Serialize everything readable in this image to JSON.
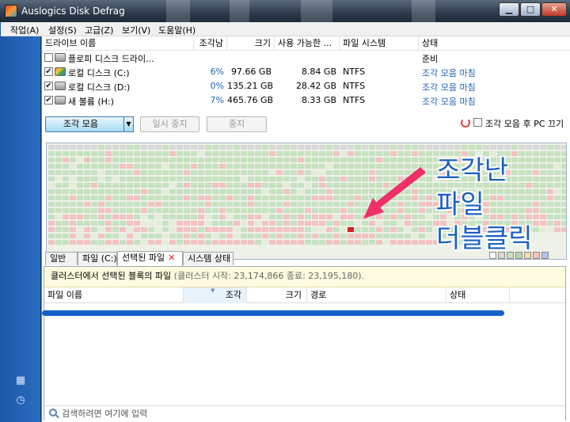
{
  "window": {
    "title": "Auslogics Disk Defrag"
  },
  "menu": [
    "작업(A)",
    "설정(S)",
    "고급(Z)",
    "보기(V)",
    "도움말(H)"
  ],
  "drive_table": {
    "headers": [
      "드라이브 이름",
      "조각남",
      "크기",
      "사용 가능한 ...",
      "파일 시스템",
      "상태"
    ],
    "rows": [
      {
        "checked": false,
        "name": "플로피 디스크 드라이...",
        "frag": "",
        "size": "",
        "free": "",
        "fs": "",
        "status": "준비",
        "icon": "floppy-drive-icon"
      },
      {
        "checked": true,
        "name": "로컬 디스크 (C:)",
        "frag": "6%",
        "size": "97.66 GB",
        "free": "8.84 GB",
        "fs": "NTFS",
        "status": "조각 모음 마침",
        "icon": "windows-drive-icon"
      },
      {
        "checked": true,
        "name": "로컬 디스크 (D:)",
        "frag": "0%",
        "size": "135.21 GB",
        "free": "28.42 GB",
        "fs": "NTFS",
        "status": "조각 모음 마침",
        "icon": "hard-drive-icon"
      },
      {
        "checked": true,
        "name": "새 볼륨 (H:)",
        "frag": "7%",
        "size": "465.76 GB",
        "free": "8.33 GB",
        "fs": "NTFS",
        "status": "조각 모음 마침",
        "icon": "hard-drive-icon"
      }
    ]
  },
  "toolbar": {
    "defrag_label": "조각 모음",
    "pause_label": "일시 중지",
    "stop_label": "중지",
    "shutdown_label": "조각 모음 후 PC 끄기"
  },
  "annotation": {
    "lines": [
      "조각난",
      "파일",
      "더블클릭"
    ],
    "color": "#1a5fc4"
  },
  "tabs": [
    {
      "label": "일반",
      "active": false
    },
    {
      "label": "파일 (C:)",
      "active": false
    },
    {
      "label": "선택된 파일",
      "active": true,
      "close": "✕"
    },
    {
      "label": "시스템 상태",
      "active": false
    }
  ],
  "info": {
    "main": "클러스터에서 선택된 블록의 파일",
    "detail": "(클러스터 시작: 23,174,866 종료: 23,195,180)."
  },
  "file_list": {
    "headers": [
      "파일 이름",
      "조각",
      "크기",
      "경로",
      "상태"
    ]
  },
  "search": {
    "placeholder": "검색하려면 여기에 입력"
  },
  "colors": {
    "fragmented": "#f3c2c2",
    "used": "#c6e2c0",
    "selected": "#d02020",
    "accent": "#1f5fb8"
  }
}
